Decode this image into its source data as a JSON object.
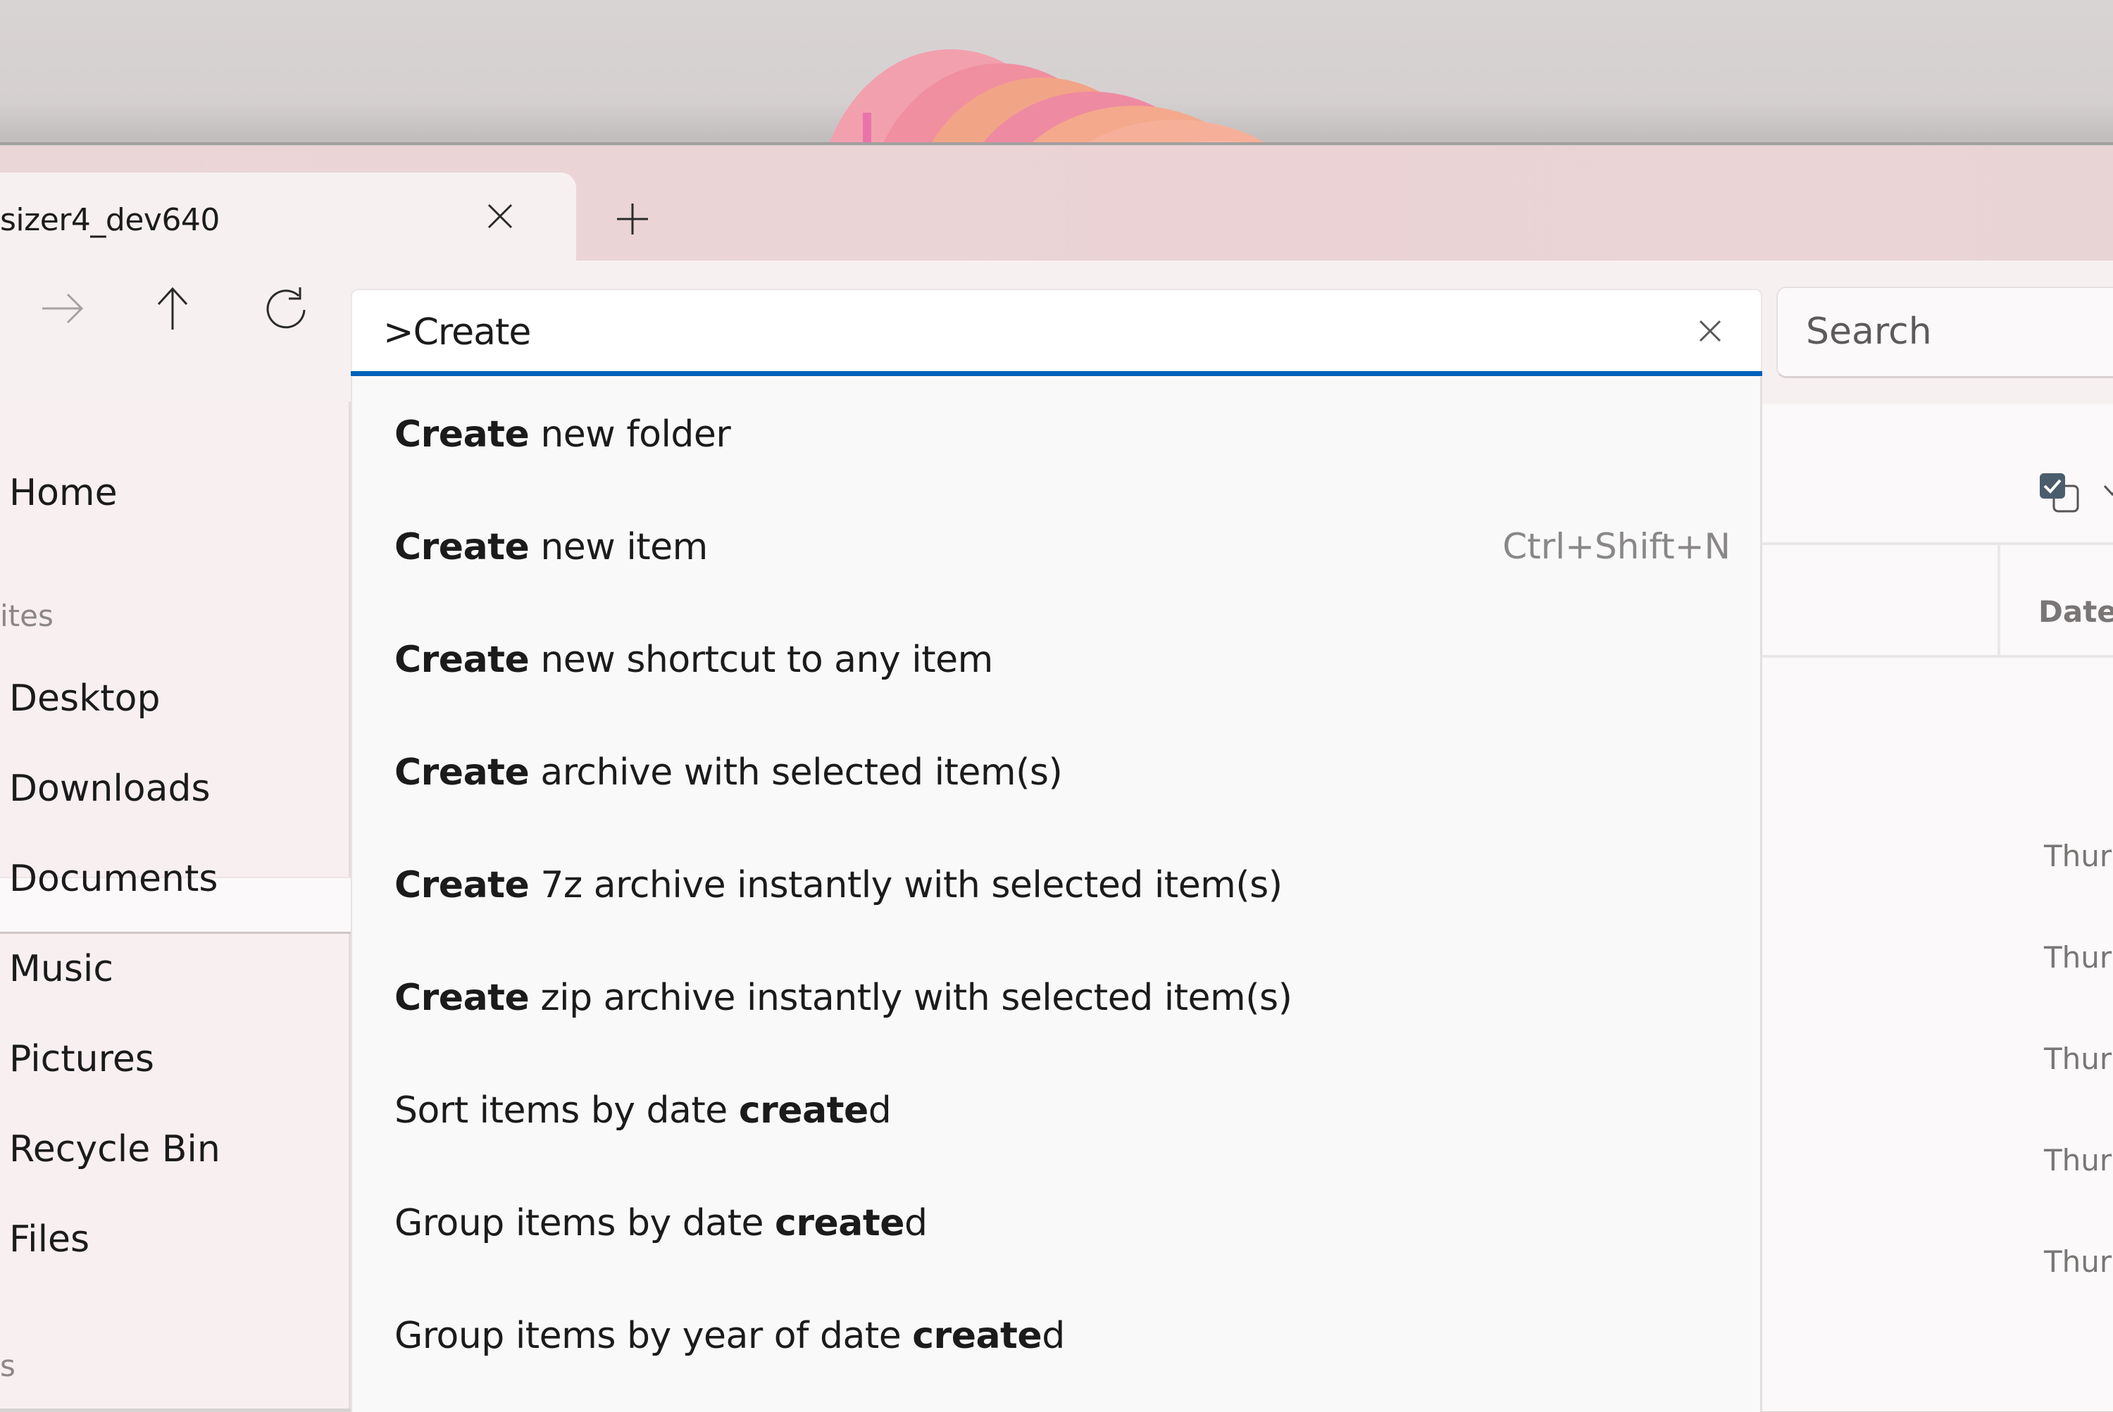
{
  "window": {
    "tab_title": "sizer4_dev640",
    "close_tab_icon": "close-icon",
    "new_tab_icon": "plus-icon"
  },
  "toolbar": {
    "forward_icon": "arrow-right-icon",
    "up_icon": "arrow-up-icon",
    "refresh_icon": "refresh-icon",
    "address_value": ">Create",
    "clear_icon": "close-icon",
    "search_placeholder": "Search",
    "accent_color": "#0060b8"
  },
  "sidebar": {
    "items": [
      {
        "label": "Home",
        "type": "item"
      },
      {
        "label": "ites",
        "type": "header"
      },
      {
        "label": "Desktop",
        "type": "item"
      },
      {
        "label": "Downloads",
        "type": "item",
        "selected": true
      },
      {
        "label": "Documents",
        "type": "item"
      },
      {
        "label": "Music",
        "type": "item"
      },
      {
        "label": "Pictures",
        "type": "item"
      },
      {
        "label": "Recycle Bin",
        "type": "item"
      },
      {
        "label": "Files",
        "type": "item"
      },
      {
        "label": "s",
        "type": "header"
      }
    ]
  },
  "command_palette": {
    "query": "Create",
    "items": [
      {
        "pre": "",
        "match": "Create",
        "post": " new folder",
        "shortcut": ""
      },
      {
        "pre": "",
        "match": "Create",
        "post": " new item",
        "shortcut": "Ctrl+Shift+N"
      },
      {
        "pre": "",
        "match": "Create",
        "post": " new shortcut to any item",
        "shortcut": ""
      },
      {
        "pre": "",
        "match": "Create",
        "post": " archive with selected item(s)",
        "shortcut": ""
      },
      {
        "pre": "",
        "match": "Create",
        "post": " 7z archive instantly with selected item(s)",
        "shortcut": ""
      },
      {
        "pre": "",
        "match": "Create",
        "post": " zip archive instantly with selected item(s)",
        "shortcut": ""
      },
      {
        "pre": "Sort items by date ",
        "match": "create",
        "post": "d",
        "shortcut": ""
      },
      {
        "pre": "Group items by date ",
        "match": "create",
        "post": "d",
        "shortcut": ""
      },
      {
        "pre": "Group items by year of date ",
        "match": "create",
        "post": "d",
        "shortcut": ""
      }
    ]
  },
  "content": {
    "select_toggle_icon": "multi-select-checkbox-icon",
    "column_header": "Date",
    "rows": [
      "Thur",
      "Thur",
      "Thur",
      "Thur",
      "Thur"
    ]
  }
}
